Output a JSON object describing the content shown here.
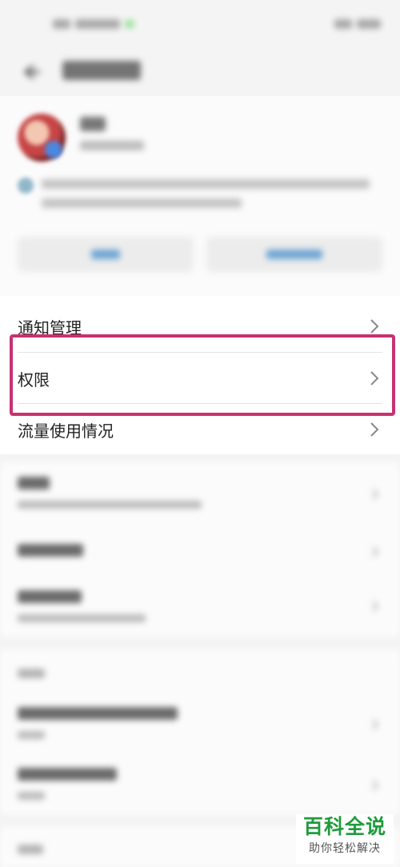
{
  "settings": {
    "items": [
      {
        "label": "通知管理"
      },
      {
        "label": "权限"
      },
      {
        "label": "流量使用情况"
      }
    ]
  },
  "watermark": {
    "title": "百科全说",
    "subtitle": "助你轻松解决"
  },
  "icons": {
    "back": "arrow-left-icon",
    "chevron": "chevron-right-icon",
    "info": "info-icon"
  },
  "colors": {
    "highlight": "#c83271",
    "watermark_green": "#1f9b3c",
    "button_text": "#3f86c4"
  }
}
